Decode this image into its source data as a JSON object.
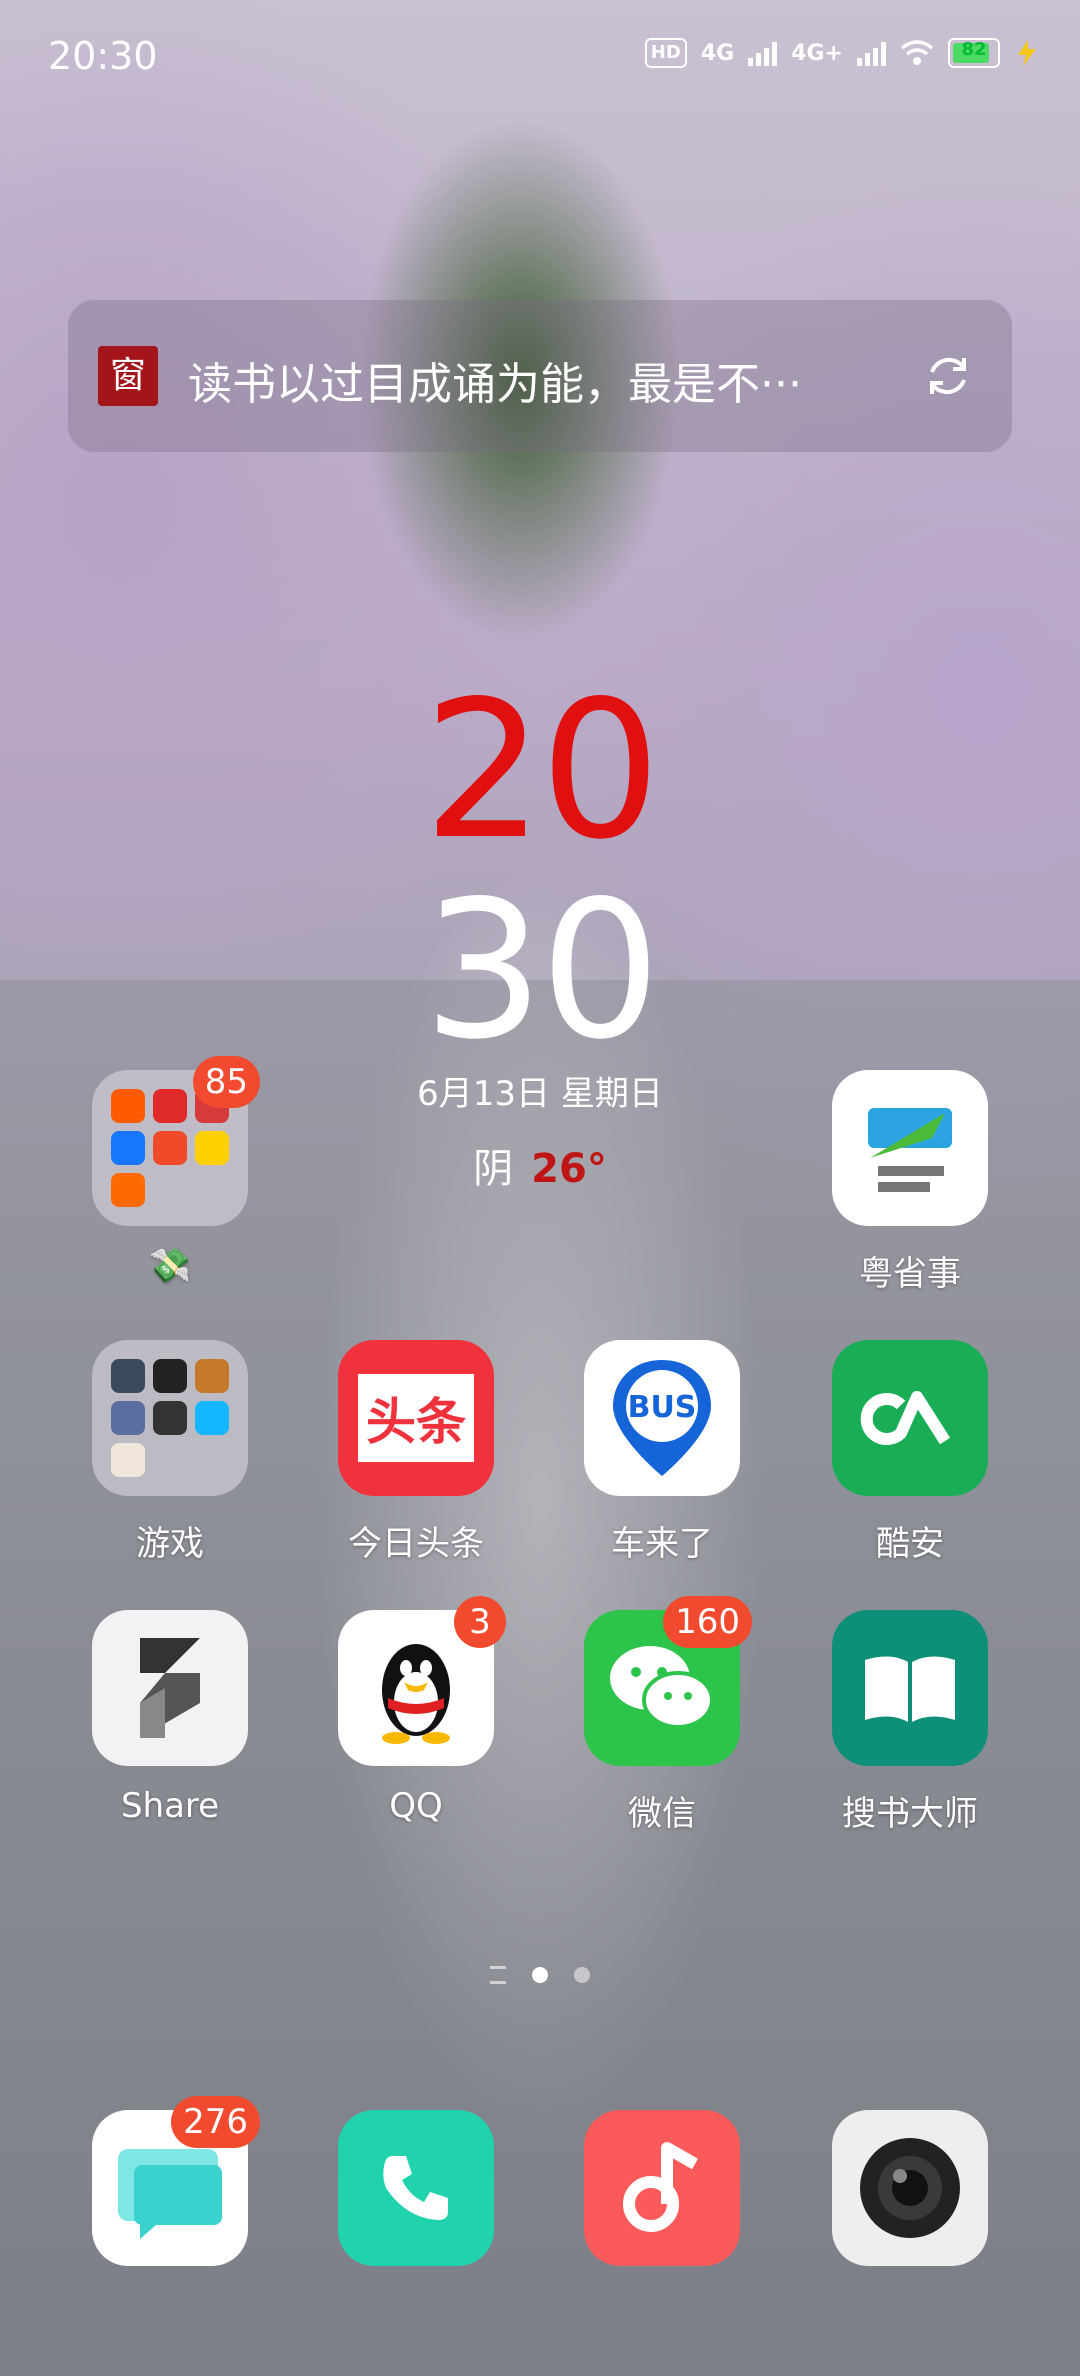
{
  "status_bar": {
    "time": "20:30",
    "hd_label": "HD",
    "net1": "4G",
    "net2": "4G+",
    "battery": "82"
  },
  "poem_widget": {
    "seal": "窗",
    "text": "读书以过目成诵为能，最是不···"
  },
  "clock": {
    "hour": "20",
    "minute": "30",
    "date": "6月13日 星期日",
    "weather": "阴",
    "temperature": "26°"
  },
  "apps": {
    "folder1": {
      "label": "💸",
      "badge": "85"
    },
    "yueshengshi": {
      "label": "粤省事"
    },
    "games": {
      "label": "游戏"
    },
    "toutiao": {
      "label": "今日头条",
      "icon_text": "头条"
    },
    "chelaile": {
      "label": "车来了",
      "icon_text": "BUS"
    },
    "coolapk": {
      "label": "酷安"
    },
    "share": {
      "label": "Share"
    },
    "qq": {
      "label": "QQ",
      "badge": "3"
    },
    "wechat": {
      "label": "微信",
      "badge": "160"
    },
    "soushu": {
      "label": "搜书大师"
    }
  },
  "dock": {
    "messages_badge": "276"
  },
  "colors": {
    "clock_hour": "#e01010",
    "badge": "#f24a2e",
    "wechat": "#2dc44c",
    "toutiao": "#f0323c",
    "coolapk": "#19ae56",
    "phone": "#20d3ad",
    "music": "#fb5a5a"
  }
}
